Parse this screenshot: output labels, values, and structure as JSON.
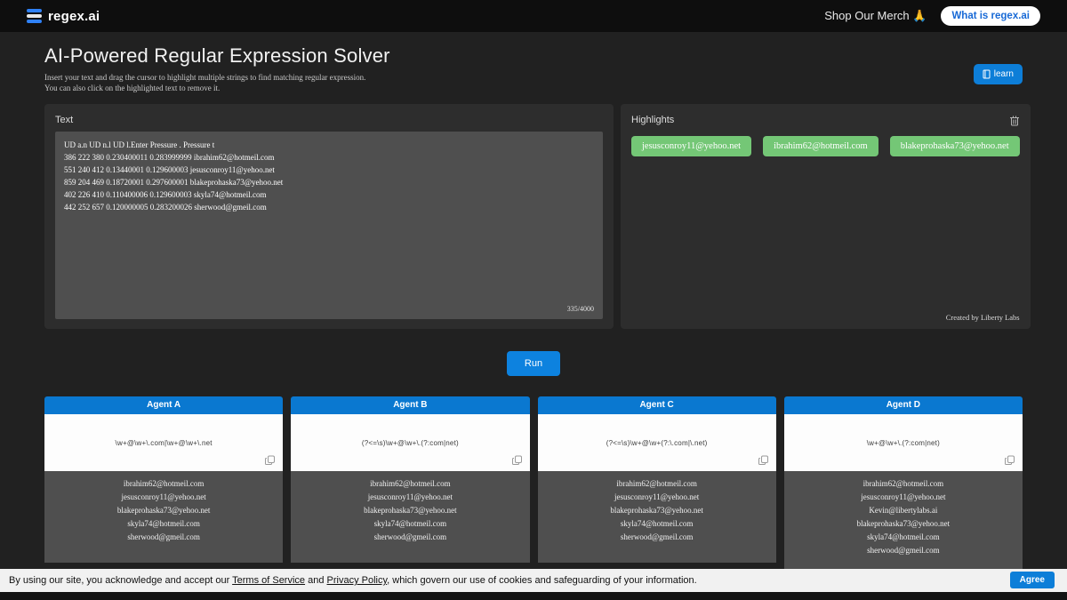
{
  "topbar": {
    "logo_text": "regex.ai",
    "merch_label": "Shop Our Merch 🙏",
    "what_is_label": "What is regex.ai"
  },
  "header": {
    "title": "AI-Powered Regular Expression Solver",
    "subtitle_line1": "Insert your text and drag the cursor to highlight multiple strings to find matching regular expression.",
    "subtitle_line2": "You can also click on the highlighted text to remove it.",
    "learn_label": "learn"
  },
  "text_panel": {
    "label": "Text",
    "content_lines": [
      "UD a.n UD n.l UD l.Enter Pressure . Pressure t",
      "386 222 380 0.230400011 0.283999999 ibrahim62@hotmeil.com",
      "551 240 412 0.13440001 0.129600003 jesusconroy11@yehoo.net",
      "859 204 469 0.18720001 0.297600001 blakeprohaska73@yehoo.net",
      "402 226 410 0.110400006 0.129600003 skyla74@hotmeil.com",
      "442 252 657 0.120000005 0.283200026 sherwood@gmeil.com"
    ],
    "char_count": "335/4000"
  },
  "highlights_panel": {
    "label": "Highlights",
    "chips": [
      "jesusconroy11@yehoo.net",
      "ibrahim62@hotmeil.com",
      "blakeprohaska73@yehoo.net"
    ],
    "credit": "Created by Liberty Labs"
  },
  "run_label": "Run",
  "agents": [
    {
      "name": "Agent A",
      "regex": "\\w+@\\w+\\.com|\\w+@\\w+\\.net",
      "results": [
        "ibrahim62@hotmeil.com",
        "jesusconroy11@yehoo.net",
        "blakeprohaska73@yehoo.net",
        "skyla74@hotmeil.com",
        "sherwood@gmeil.com"
      ]
    },
    {
      "name": "Agent B",
      "regex": "(?<=\\s)\\w+@\\w+\\.(?:com|net)",
      "results": [
        "ibrahim62@hotmeil.com",
        "jesusconroy11@yehoo.net",
        "blakeprohaska73@yehoo.net",
        "skyla74@hotmeil.com",
        "sherwood@gmeil.com"
      ]
    },
    {
      "name": "Agent C",
      "regex": "(?<=\\s)\\w+@\\w+(?:\\.com|\\.net)",
      "results": [
        "ibrahim62@hotmeil.com",
        "jesusconroy11@yehoo.net",
        "blakeprohaska73@yehoo.net",
        "skyla74@hotmeil.com",
        "sherwood@gmeil.com"
      ]
    },
    {
      "name": "Agent D",
      "regex": "\\w+@\\w+\\.(?:com|net)",
      "results": [
        "ibrahim62@hotmeil.com",
        "jesusconroy11@yehoo.net",
        "Kevin@libertylabs.ai",
        "blakeprohaska73@yehoo.net",
        "skyla74@hotmeil.com",
        "sherwood@gmeil.com"
      ]
    }
  ],
  "footer": {
    "text_before": "By using our site, you acknowledge and accept our ",
    "terms_label": "Terms of Service",
    "text_mid": " and ",
    "privacy_label": "Privacy Policy",
    "text_after": ", which govern our use of cookies and safeguarding of your information.",
    "agree_label": "Agree"
  },
  "colors": {
    "accent_blue": "#0d7ed8",
    "agent_header_blue": "#0a78d0",
    "chip_green": "#74c776",
    "page_bg": "#212121",
    "panel_bg": "#2d2d2d",
    "input_bg": "#4f4f4f",
    "footer_bg": "#f1f1f1"
  }
}
